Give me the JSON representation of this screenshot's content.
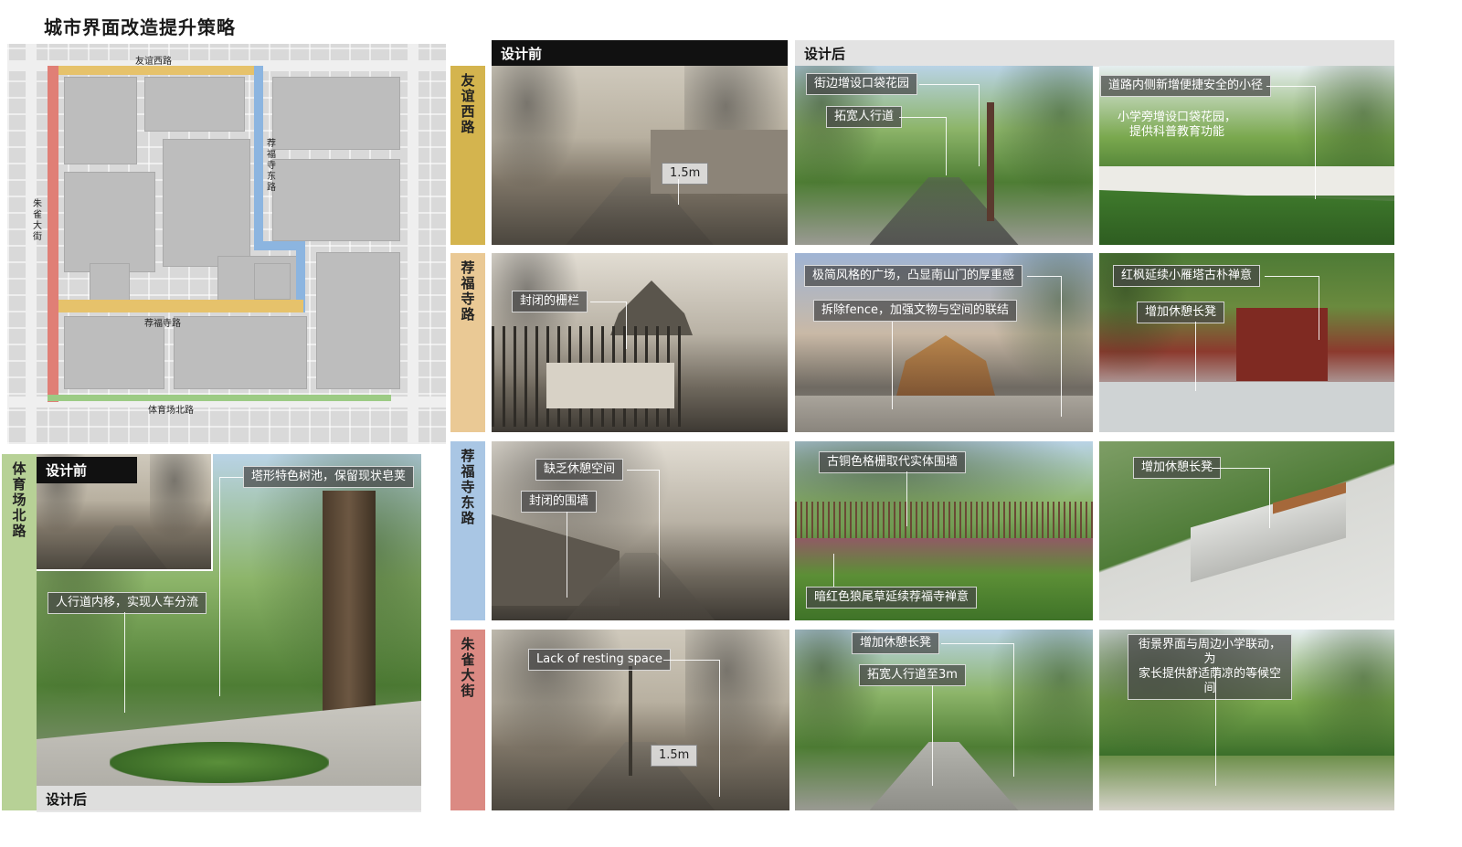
{
  "page_title": "城市界面改造提升策略",
  "colors": {
    "yellow": "#d4b44e",
    "peach": "#eac995",
    "blue": "#a9c6e4",
    "red": "#db8a83",
    "green": "#b7d196",
    "map_yellow": "#e6c26b",
    "map_blue": "#8cb5e0",
    "map_red": "#e07f76",
    "map_green": "#9ccb84"
  },
  "map": {
    "labels": {
      "youyi_west": "友谊西路",
      "jianfusi_east": "荐福寺东路",
      "zhuque": "朱雀大街",
      "jianfusi": "荐福寺路",
      "tiyuchang_north": "体育场北路"
    }
  },
  "headers": {
    "before": "设计前",
    "after": "设计后",
    "bottom_before": "设计前",
    "bottom_after": "设计后"
  },
  "roads": {
    "r1": "友谊西路",
    "r2": "荐福寺路",
    "r3": "荐福寺东路",
    "r4": "朱雀大街",
    "left": "体育场北路"
  },
  "callouts": {
    "r1_before": "1.5m",
    "r1_after1_a": "街边增设口袋花园",
    "r1_after1_b": "拓宽人行道",
    "r1_after2_a": "道路内侧新增便捷安全的小径",
    "r1_after2_b": "小学旁增设口袋花园，\n提供科普教育功能",
    "r2_before": "封闭的栅栏",
    "r2_after1_a": "极简风格的广场，凸显南山门的厚重感",
    "r2_after1_b": "拆除fence，加强文物与空间的联结",
    "r2_after2_a": "红枫延续小雁塔古朴禅意",
    "r2_after2_b": "增加休憩长凳",
    "r3_before_a": "缺乏休憩空间",
    "r3_before_b": "封闭的围墙",
    "r3_after1_a": "古铜色格栅取代实体围墙",
    "r3_after1_b": "暗红色狼尾草延续荐福寺禅意",
    "r3_after2": "增加休憩长凳",
    "r4_before_a": "Lack of resting space",
    "r4_before_b": "1.5m",
    "r4_after1_a": "增加休憩长凳",
    "r4_after1_b": "拓宽人行道至3m",
    "r4_after2": "街景界面与周边小学联动，为\n家长提供舒适荫凉的等候空间",
    "left_a": "塔形特色树池，保留现状皂荚",
    "left_b": "人行道内移，实现人车分流"
  }
}
